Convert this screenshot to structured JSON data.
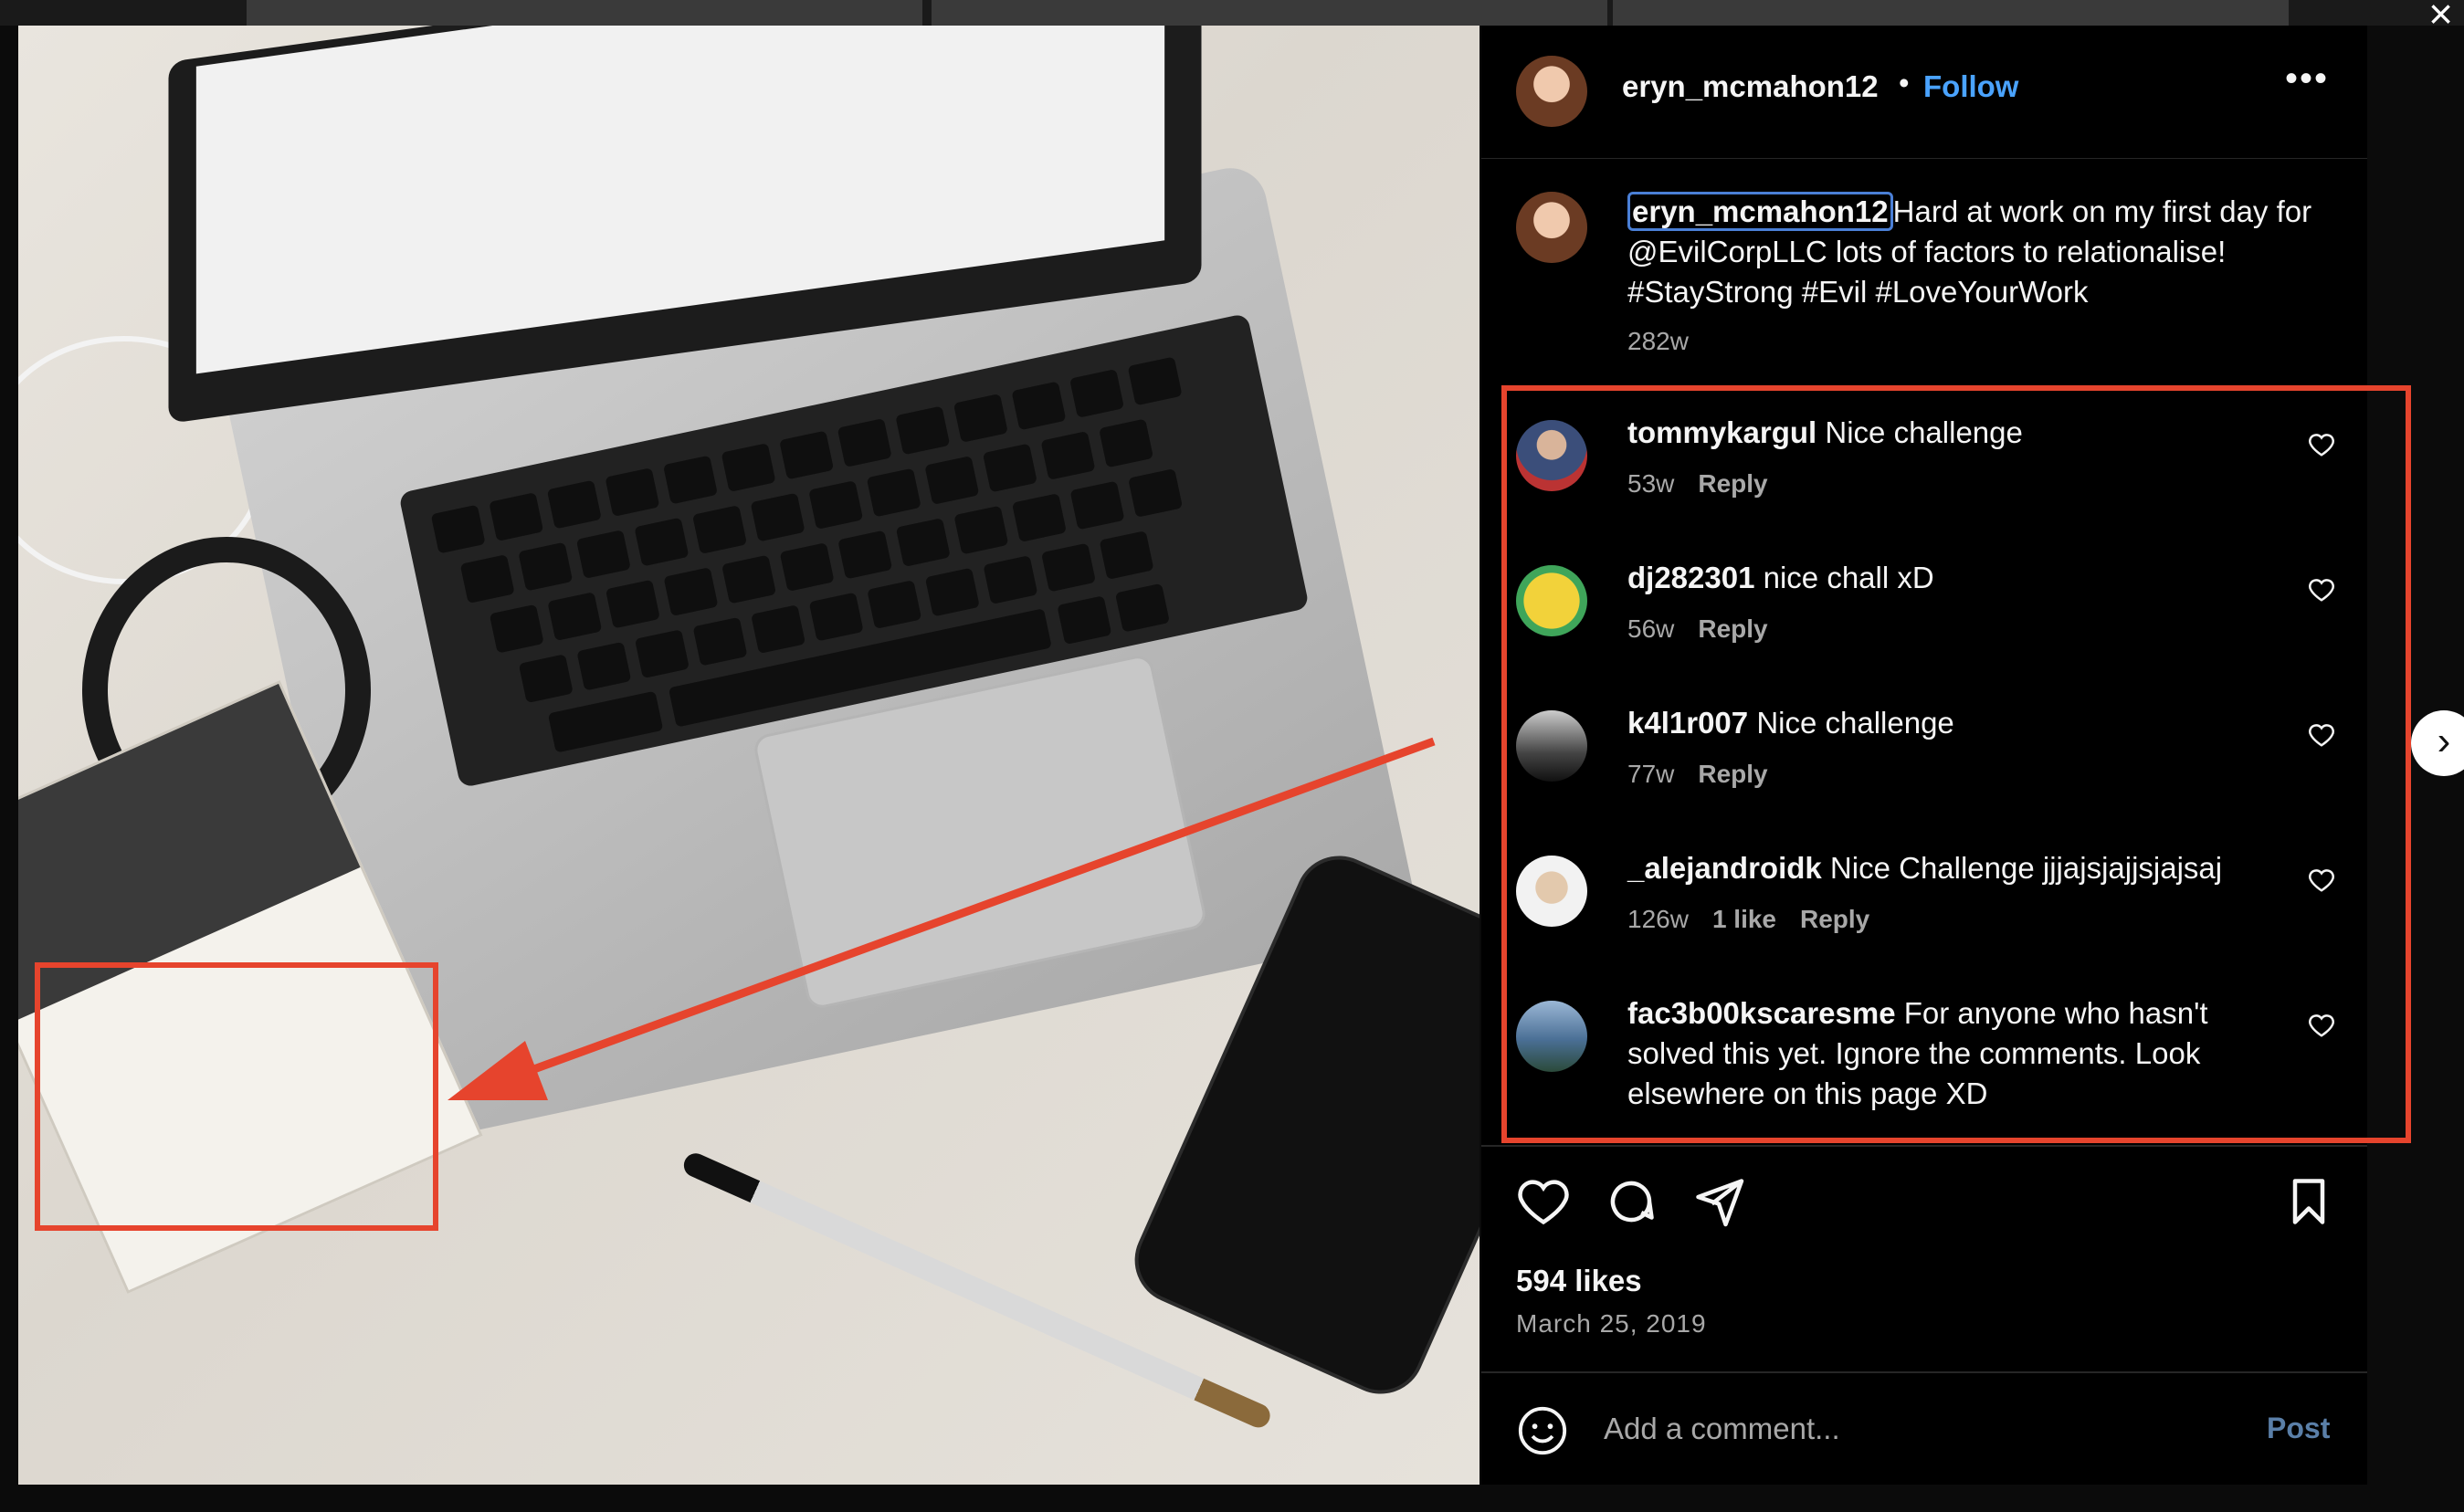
{
  "close_icon": "close-icon",
  "post": {
    "username": "eryn_mcmahon12",
    "separator": "•",
    "follow_label": "Follow",
    "more_icon": "more-horizontal-icon",
    "caption_user": "eryn_mcmahon12",
    "caption_text": "Hard at work on my first day for @EvilCorpLLC lots of factors to relationalise! #StayStrong #Evil #LoveYourWork",
    "caption_time": "282w"
  },
  "comments": [
    {
      "user": "tommykargul",
      "text": "Nice challenge",
      "time": "53w",
      "likes": "",
      "reply": "Reply"
    },
    {
      "user": "dj282301",
      "text": "nice chall xD",
      "time": "56w",
      "likes": "",
      "reply": "Reply"
    },
    {
      "user": "k4l1r007",
      "text": "Nice challenge",
      "time": "77w",
      "likes": "",
      "reply": "Reply"
    },
    {
      "user": "_alejandroidk",
      "text": "Nice Challenge jjjajsjajjsjajsaj",
      "time": "126w",
      "likes": "1 like",
      "reply": "Reply"
    },
    {
      "user": "fac3b00kscaresme",
      "text": "For anyone who hasn't solved this yet. Ignore the comments. Look elsewhere on this page XD",
      "time": "",
      "likes": "",
      "reply": ""
    }
  ],
  "actions": {
    "like_icon": "heart-icon",
    "comment_icon": "comment-icon",
    "share_icon": "send-icon",
    "save_icon": "bookmark-icon"
  },
  "likes_count": "594 likes",
  "date": "March 25, 2019",
  "composer": {
    "emoji_icon": "emoji-icon",
    "placeholder": "Add a comment...",
    "post_label": "Post"
  },
  "colors": {
    "annotation_red": "#e6442d",
    "follow_blue": "#4aa3ff",
    "panel_bg": "#000000"
  },
  "next_icon": "chevron-right-icon"
}
